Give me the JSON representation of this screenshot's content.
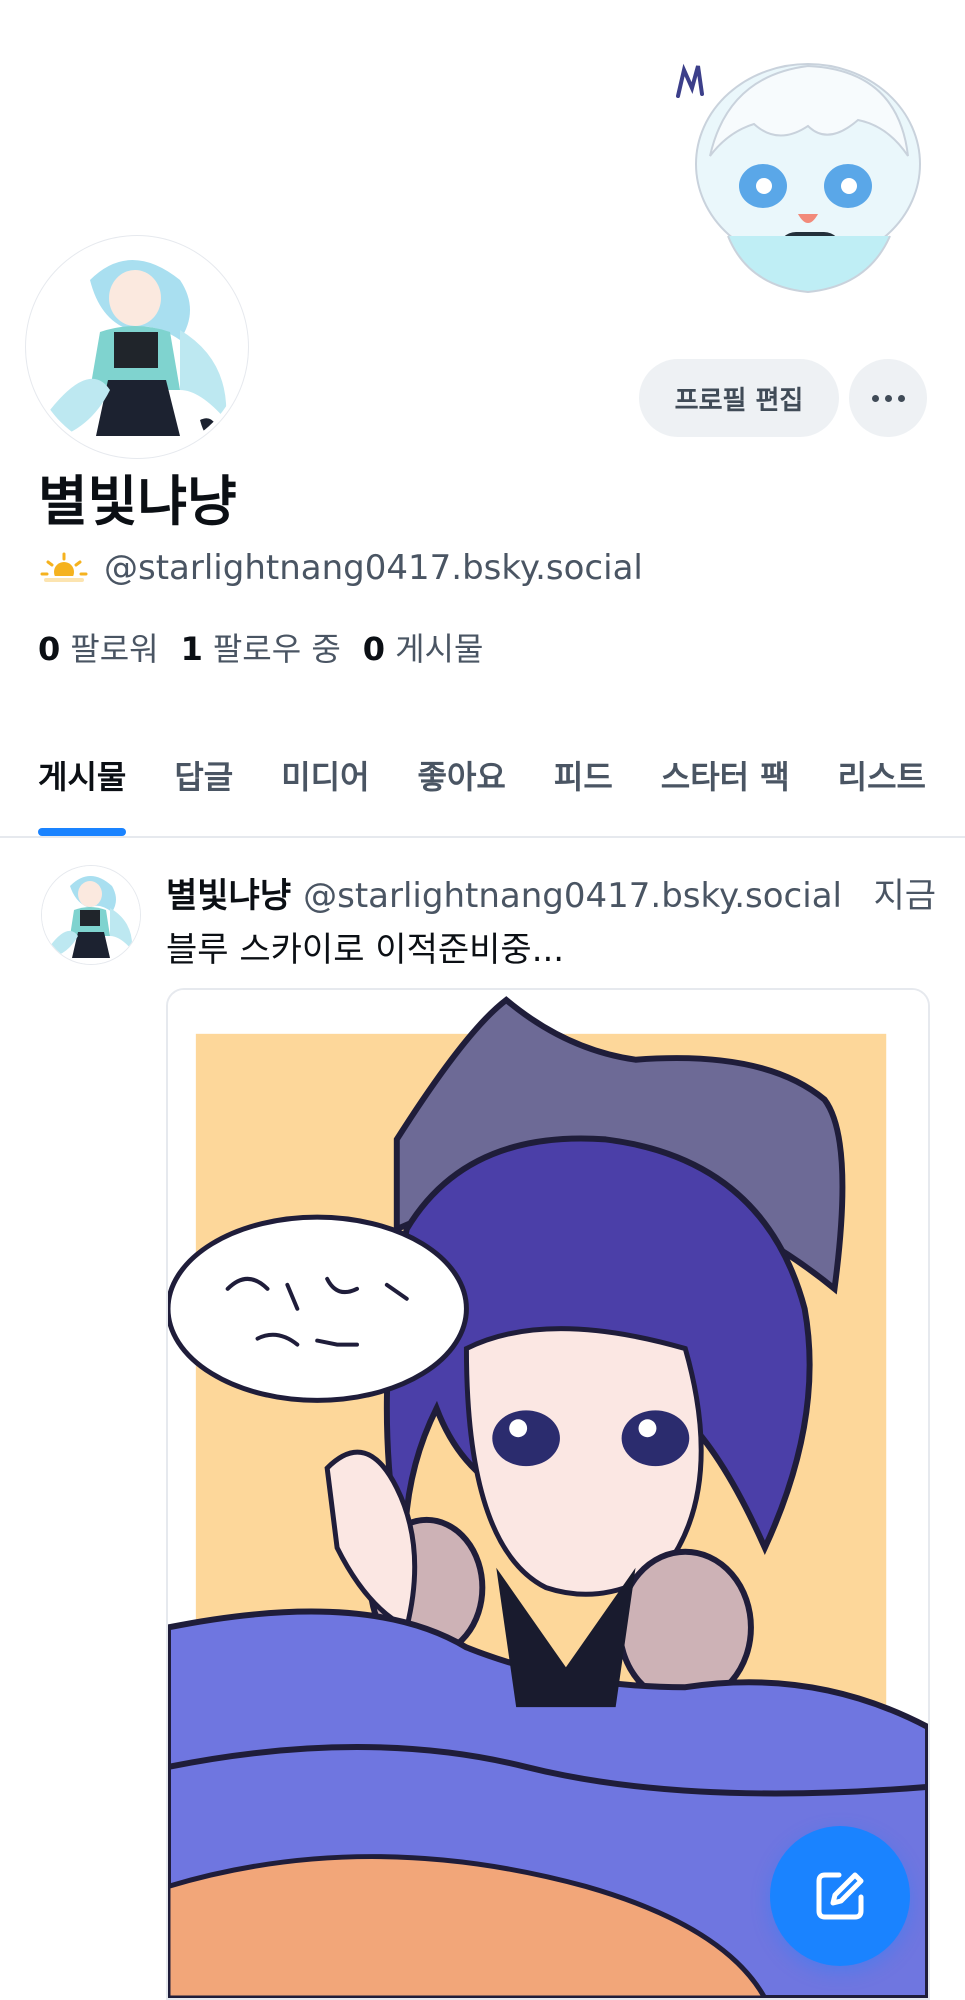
{
  "profile": {
    "display_name": "별빛냐냥",
    "handle": "@starlightnang0417.bsky.social",
    "status_icon": "sun-behind-cloud-icon",
    "edit_label": "프로필 편집",
    "more_icon": "ellipsis-icon"
  },
  "stats": {
    "followers_count": "0",
    "followers_label": "팔로워",
    "following_count": "1",
    "following_label": "팔로우 중",
    "posts_count": "0",
    "posts_label": "게시물"
  },
  "tabs": [
    {
      "label": "게시물",
      "active": true
    },
    {
      "label": "답글"
    },
    {
      "label": "미디어"
    },
    {
      "label": "좋아요"
    },
    {
      "label": "피드"
    },
    {
      "label": "스타터 팩"
    },
    {
      "label": "리스트"
    }
  ],
  "post": {
    "author": "별빛냐냥",
    "handle": "@starlightnang0417.bsky.social",
    "time": "지금",
    "text": "블루 스카이로 이적준비중..."
  },
  "fab": {
    "icon": "compose-icon"
  },
  "colors": {
    "accent": "#1a83ff",
    "button_bg": "#eef1f4",
    "text_primary": "#0b0f14",
    "text_secondary": "#4a5563"
  }
}
